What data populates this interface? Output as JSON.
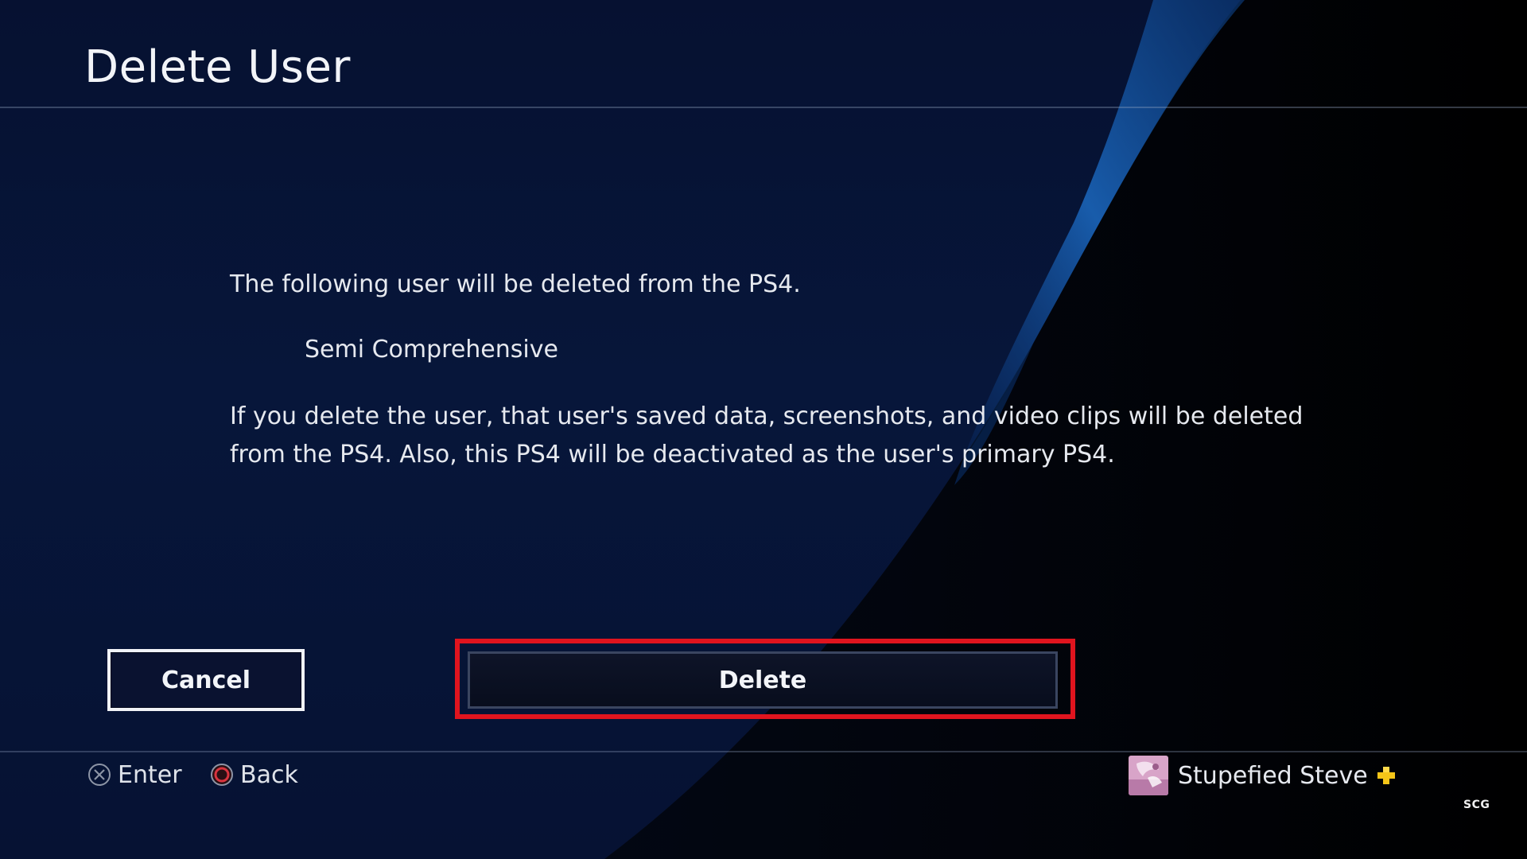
{
  "header": {
    "title": "Delete User"
  },
  "dialog": {
    "intro": "The following user will be deleted from the PS4.",
    "username": "Semi Comprehensive",
    "warning": "If you delete the user, that user's saved data, screenshots, and video clips will be deleted from the PS4. Also, this PS4 will be deactivated as the user's primary PS4."
  },
  "buttons": {
    "cancel_label": "Cancel",
    "delete_label": "Delete"
  },
  "footer": {
    "enter_label": "Enter",
    "back_label": "Back",
    "enter_icon": "cross-button-icon",
    "back_icon": "circle-button-icon",
    "user_name": "Stupefied Steve",
    "plus_icon": "playstation-plus-icon"
  },
  "watermark": "SCG",
  "colors": {
    "highlight": "#e0141e",
    "plus": "#f5c518",
    "background": "#061233"
  }
}
